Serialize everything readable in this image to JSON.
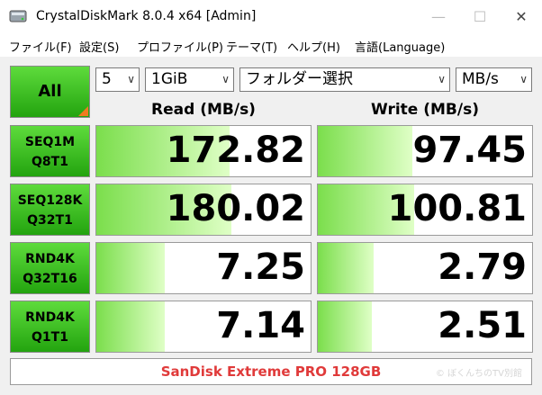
{
  "window": {
    "title": "CrystalDiskMark 8.0.4 x64 [Admin]",
    "minimize": "—",
    "maximize": "☐",
    "close": "✕"
  },
  "menu": [
    "ファイル(F)",
    "設定(S)",
    "プロファイル(P)",
    "テーマ(T)",
    "ヘルプ(H)",
    "言語(Language)"
  ],
  "controls": {
    "all_label": "All",
    "count": "5",
    "size": "1GiB",
    "target": "フォルダー選択",
    "unit": "MB/s"
  },
  "columns": {
    "read": "Read (MB/s)",
    "write": "Write (MB/s)"
  },
  "rows": [
    {
      "line1": "SEQ1M",
      "line2": "Q8T1",
      "read": "172.82",
      "write": "97.45",
      "read_level": 0.62,
      "write_level": 0.44
    },
    {
      "line1": "SEQ128K",
      "line2": "Q32T1",
      "read": "180.02",
      "write": "100.81",
      "read_level": 0.63,
      "write_level": 0.45
    },
    {
      "line1": "RND4K",
      "line2": "Q32T16",
      "read": "7.25",
      "write": "2.79",
      "read_level": 0.32,
      "write_level": 0.26
    },
    {
      "line1": "RND4K",
      "line2": "Q1T1",
      "read": "7.14",
      "write": "2.51",
      "read_level": 0.32,
      "write_level": 0.25
    }
  ],
  "comment": "SanDisk  Extreme PRO 128GB",
  "watermark": "© ぼくんちのTV別館",
  "colors": {
    "button_green": "#23a40f",
    "fill_green": "#7bde4c",
    "comment_red": "#e03a3a",
    "accent_orange": "#f07b20"
  }
}
